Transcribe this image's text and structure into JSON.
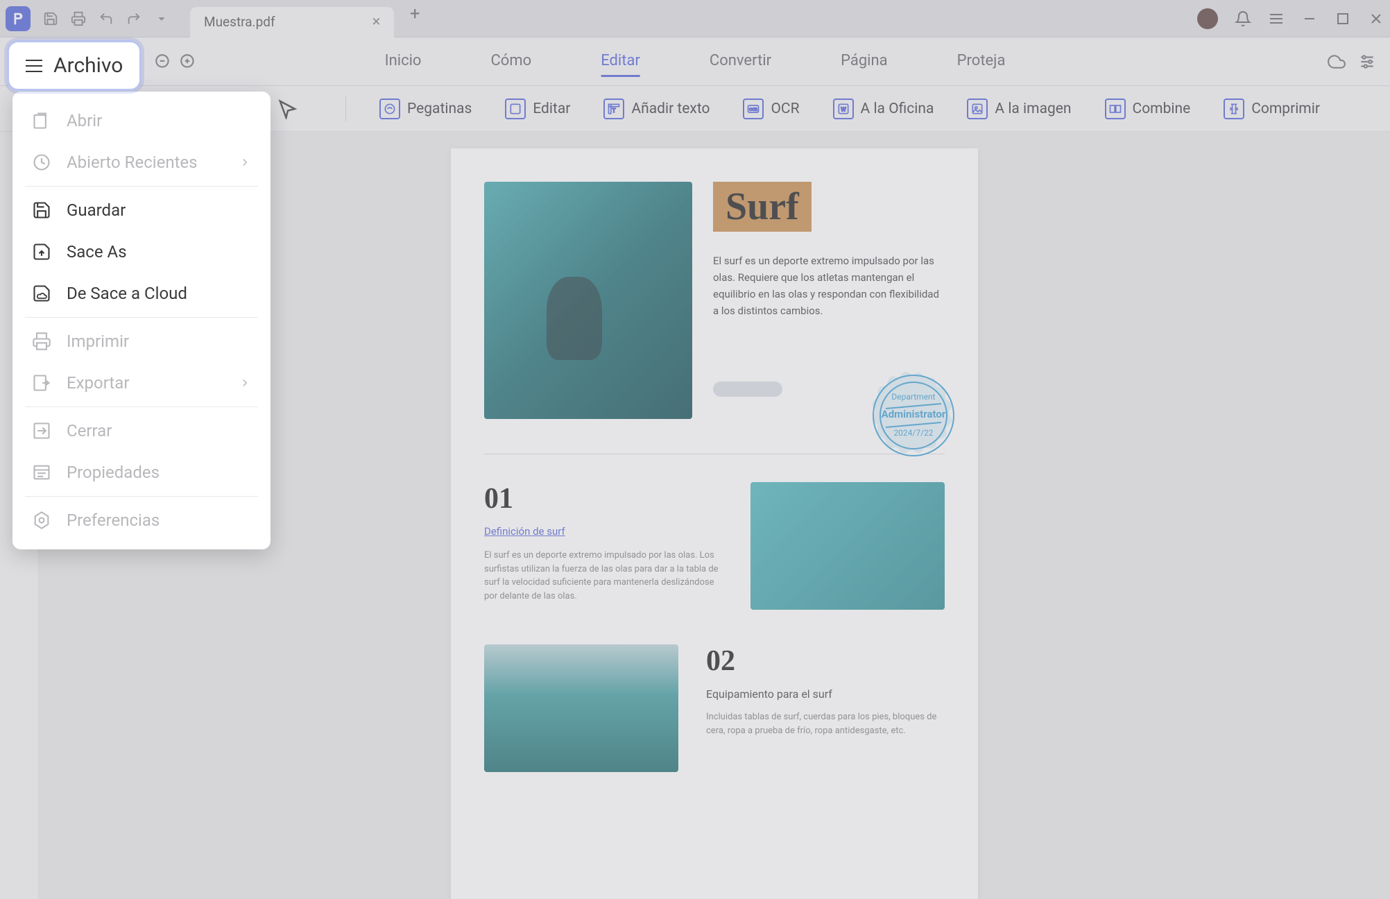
{
  "titlebar": {
    "tab_name": "Muestra.pdf"
  },
  "main_nav": {
    "items": [
      "Inicio",
      "Cómo",
      "Editar",
      "Convertir",
      "Página",
      "Proteja"
    ],
    "active_index": 2
  },
  "toolbar": {
    "tools": [
      "Pegatinas",
      "Editar",
      "Añadir texto",
      "OCR",
      "A la Oficina",
      "A la imagen",
      "Combine",
      "Comprimir"
    ]
  },
  "archivo_button": "Archivo",
  "menu": {
    "items": [
      {
        "label": "Abrir",
        "icon": "open",
        "disabled": true
      },
      {
        "label": "Abierto Recientes",
        "icon": "recent",
        "disabled": true,
        "chevron": true
      },
      {
        "divider": true
      },
      {
        "label": "Guardar",
        "icon": "save",
        "disabled": false
      },
      {
        "label": "Sace As",
        "icon": "saveas",
        "disabled": false
      },
      {
        "label": "De Sace a Cloud",
        "icon": "cloud",
        "disabled": false
      },
      {
        "divider": true
      },
      {
        "label": "Imprimir",
        "icon": "print",
        "disabled": true
      },
      {
        "label": "Exportar",
        "icon": "export",
        "disabled": true,
        "chevron": true
      },
      {
        "divider": true
      },
      {
        "label": "Cerrar",
        "icon": "close",
        "disabled": true
      },
      {
        "label": "Propiedades",
        "icon": "props",
        "disabled": true
      },
      {
        "divider": true
      },
      {
        "label": "Preferencias",
        "icon": "prefs",
        "disabled": true
      }
    ]
  },
  "document": {
    "hero": {
      "title": "Surf",
      "desc": "El surf es un deporte extremo impulsado por las olas. Requiere que los atletas mantengan el equilibrio en las olas y respondan con flexibilidad a los distintos cambios."
    },
    "stamp": {
      "line1": "Department",
      "line2": "Administrator",
      "line3": "2024/7/22"
    },
    "section1": {
      "num": "01",
      "link": "Definición de surf",
      "desc": "El surf es un deporte extremo impulsado por las olas. Los surfistas utilizan la fuerza de las olas para dar a la tabla de surf la velocidad suficiente para mantenerla deslizándose por delante de las olas."
    },
    "section2": {
      "num": "02",
      "title": "Equipamiento para el surf",
      "desc": "Incluidas tablas de surf, cuerdas para los pies, bloques de cera, ropa a prueba de frío, ropa antidesgaste, etc."
    }
  }
}
